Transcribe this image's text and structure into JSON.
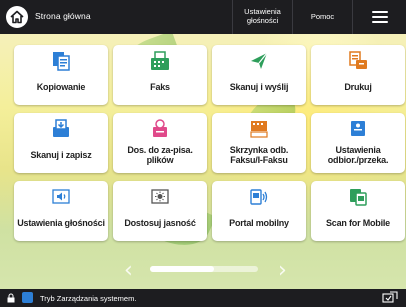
{
  "header": {
    "home_title": "Strona główna",
    "volume_label": "Ustawienia głośności",
    "help_label": "Pomoc"
  },
  "tiles": [
    {
      "label": "Kopiowanie",
      "icon": "copy-icon"
    },
    {
      "label": "Faks",
      "icon": "fax-icon"
    },
    {
      "label": "Skanuj i wyślij",
      "icon": "scan-send-icon"
    },
    {
      "label": "Drukuj",
      "icon": "print-icon"
    },
    {
      "label": "Skanuj i zapisz",
      "icon": "scan-store-icon"
    },
    {
      "label": "Dos. do za-pisa. plików",
      "icon": "file-access-icon"
    },
    {
      "label": "Skrzynka odb. Faksu/I-Faksu",
      "icon": "fax-inbox-icon"
    },
    {
      "label": "Ustawienia odbior./przeka.",
      "icon": "receive-forward-settings-icon"
    },
    {
      "label": "Ustawienia głośności",
      "icon": "volume-settings-icon"
    },
    {
      "label": "Dostosuj jasność",
      "icon": "brightness-icon"
    },
    {
      "label": "Portal mobilny",
      "icon": "mobile-portal-icon"
    },
    {
      "label": "Scan for Mobile",
      "icon": "scan-for-mobile-icon"
    }
  ],
  "pager": {
    "position": 0.0
  },
  "status": {
    "text": "Tryb Zarządzania systemem."
  },
  "colors": {
    "topbar": "#1d1d20",
    "accent_blue": "#2d7fd6",
    "accent_green": "#2e9e5b",
    "accent_orange": "#e07a1f",
    "accent_pink": "#e0498a"
  }
}
